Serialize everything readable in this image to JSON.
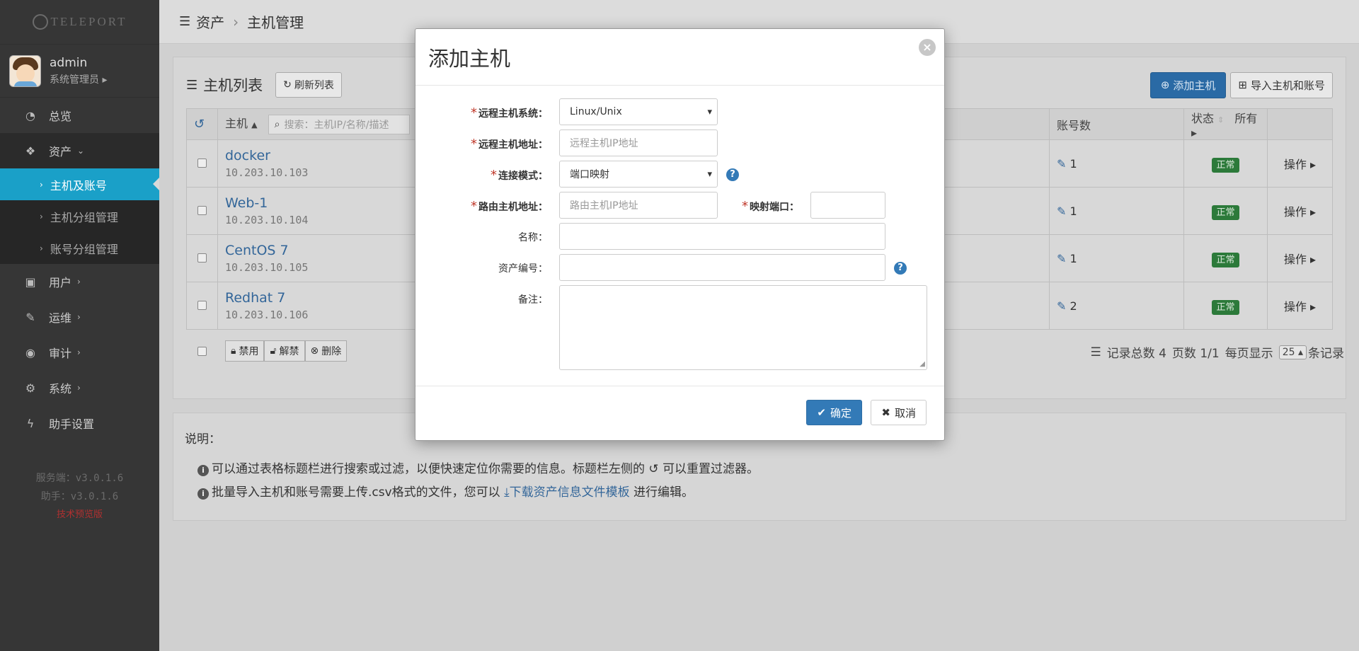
{
  "app": {
    "logo_text": "TELEPORT"
  },
  "user": {
    "name": "admin",
    "role": "系统管理员"
  },
  "sidebar": {
    "items": [
      {
        "label": "总览"
      },
      {
        "label": "资产"
      },
      {
        "label": "用户"
      },
      {
        "label": "运维"
      },
      {
        "label": "审计"
      },
      {
        "label": "系统"
      },
      {
        "label": "助手设置"
      }
    ],
    "sub_items": [
      {
        "label": "主机及账号"
      },
      {
        "label": "主机分组管理"
      },
      {
        "label": "账号分组管理"
      }
    ],
    "version_server": "服务端：v3.0.1.6",
    "version_assist": "助手：v3.0.1.6",
    "preview": "技术预览版"
  },
  "breadcrumb": {
    "root": "资产",
    "current": "主机管理"
  },
  "panel": {
    "title": "主机列表",
    "refresh": "刷新列表",
    "add_host": "添加主机",
    "import": "导入主机和账号"
  },
  "table": {
    "col_host": "主机",
    "search_placeholder": "搜索：主机IP/名称/描述",
    "col_accounts": "账号数",
    "col_status": "状态",
    "status_filter": "所有",
    "action": "操作",
    "rows": [
      {
        "name": "docker",
        "ip": "10.203.10.103",
        "accounts": "1",
        "status": "正常"
      },
      {
        "name": "Web-1",
        "ip": "10.203.10.104",
        "accounts": "1",
        "status": "正常"
      },
      {
        "name": "CentOS 7",
        "ip": "10.203.10.105",
        "accounts": "1",
        "status": "正常"
      },
      {
        "name": "Redhat 7",
        "ip": "10.203.10.106",
        "accounts": "2",
        "status": "正常"
      }
    ]
  },
  "batch": {
    "disable": "禁用",
    "enable": "解禁",
    "delete": "删除"
  },
  "pager": {
    "total": "记录总数 4",
    "pages": "页数 1/1",
    "per_page_label": "每页显示",
    "per_page": "25",
    "unit": "条记录"
  },
  "notes": {
    "title": "说明：",
    "line1_a": "可以通过表格标题栏进行搜索或过滤，以便快速定位你需要的信息。标题栏左侧的",
    "line1_b": "可以重置过滤器。",
    "line2_a": "批量导入主机和账号需要上传.csv格式的文件，您可以",
    "line2_link": "下载资产信息文件模板",
    "line2_b": "进行编辑。"
  },
  "modal": {
    "title": "添加主机",
    "os_label": "远程主机系统：",
    "os_value": "Linux/Unix",
    "addr_label": "远程主机地址：",
    "addr_placeholder": "远程主机IP地址",
    "mode_label": "连接模式：",
    "mode_value": "端口映射",
    "router_label": "路由主机地址：",
    "router_placeholder": "路由主机IP地址",
    "port_label": "映射端口：",
    "name_label": "名称：",
    "asset_label": "资产编号：",
    "remark_label": "备注：",
    "ok": "确定",
    "cancel": "取消"
  },
  "colors": {
    "accent": "#337ab7",
    "sidebar_active": "#1aa0c8",
    "status_ok": "#2c7a3a",
    "required": "#c0392b"
  }
}
